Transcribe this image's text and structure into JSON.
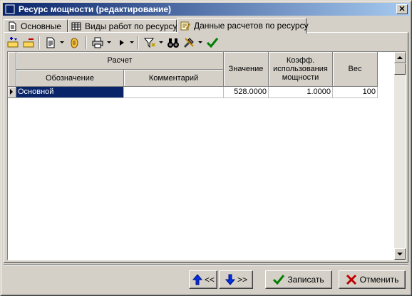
{
  "window": {
    "title": "Ресурс мощности (редактирование)",
    "close_glyph": "✕"
  },
  "tabs": [
    {
      "label": "Основные",
      "icon": "document-icon"
    },
    {
      "label": "Виды работ по ресурсу",
      "icon": "table-icon"
    },
    {
      "label": "Данные расчетов по ресурсу",
      "icon": "edit-note-icon",
      "active": true
    }
  ],
  "toolbar": {
    "buttons": [
      "add-row-icon",
      "delete-row-icon",
      "document-icon",
      "hand-icon",
      "print-icon",
      "play-icon",
      "filter-icon",
      "binoculars-icon",
      "tools-icon",
      "checkmark-icon"
    ]
  },
  "grid": {
    "group_header": "Расчет",
    "columns": {
      "designation": "Обозначение",
      "comment": "Комментарий",
      "value": "Значение",
      "coefficient": "Коэфф. использования мощности",
      "weight": "Вес"
    },
    "rows": [
      {
        "designation": "Основной",
        "comment": "",
        "value": "528.0000",
        "coefficient": "1.0000",
        "weight": "100"
      }
    ]
  },
  "buttons": {
    "prev_label": "<<",
    "next_label": ">>",
    "save_label": "Записать",
    "cancel_label": "Отменить"
  },
  "colors": {
    "title_start": "#0a246a",
    "title_end": "#a6caf0",
    "selection": "#0a246a",
    "face": "#d4d0c8"
  }
}
